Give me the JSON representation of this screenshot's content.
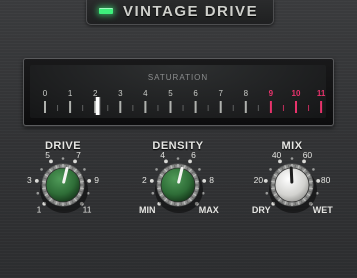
{
  "plugin": {
    "title": "VINTAGE DRIVE"
  },
  "meter": {
    "label": "SATURATION",
    "scale": [
      "0",
      "1",
      "2",
      "3",
      "4",
      "5",
      "6",
      "7",
      "8",
      "9",
      "10",
      "11"
    ],
    "red_from": 9,
    "needle_value": 2.1,
    "colors": {
      "normal": "#c9cbc7",
      "hot": "#e8336c",
      "needle": "#ffffff"
    }
  },
  "knobs": {
    "drive": {
      "label": "DRIVE",
      "scale": [
        "1",
        "3",
        "5",
        "7",
        "9",
        "11"
      ],
      "value_fraction": 0.55,
      "cap_color": "#2e6d37"
    },
    "density": {
      "label": "DENSITY",
      "scale": [
        "MIN",
        "2",
        "4",
        "6",
        "8",
        "MAX"
      ],
      "value_fraction": 0.55,
      "cap_color": "#2e6d37"
    },
    "mix": {
      "label": "MIX",
      "scale": [
        "DRY",
        "20",
        "40",
        "60",
        "80",
        "WET"
      ],
      "value_fraction": 0.49,
      "cap_color": "#d9d9d6"
    }
  }
}
